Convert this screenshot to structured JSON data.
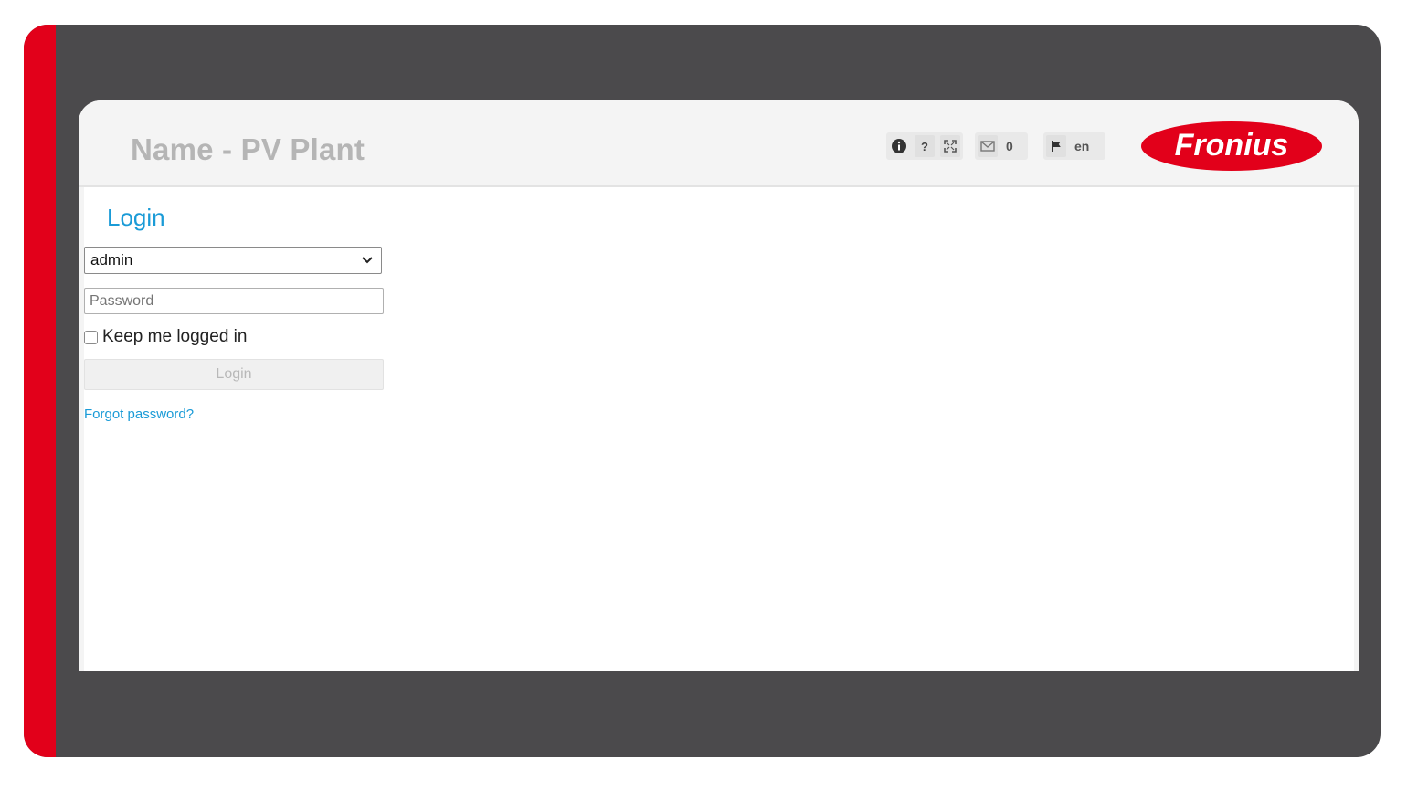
{
  "header": {
    "title": "Name - PV Plant",
    "messages_count": "0",
    "language": "en",
    "brand": "Fronius"
  },
  "login": {
    "heading": "Login",
    "user_select_value": "admin",
    "password_placeholder": "Password",
    "keep_logged_in_label": "Keep me logged in",
    "keep_logged_in_checked": false,
    "login_button_label": "Login",
    "forgot_password_label": "Forgot password?"
  },
  "icons": {
    "info": "info-icon",
    "help": "help-icon",
    "fullscreen": "fullscreen-icon",
    "messages": "envelope-icon",
    "language": "flag-icon"
  },
  "colors": {
    "brand_red": "#e2001a",
    "accent_blue": "#1a9bd7",
    "frame_dark": "#4b4a4c"
  }
}
